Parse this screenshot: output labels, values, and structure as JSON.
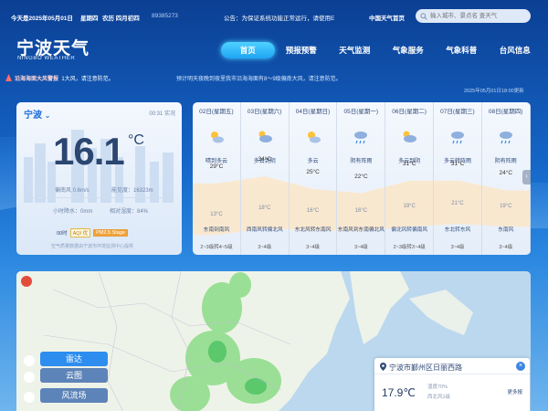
{
  "topbar": {
    "date": "今天是2025年05月01日",
    "weekday": "星期四",
    "lunar": "农历 四月初四",
    "phone": "89385273",
    "notice": "公告：为保证系统功能正常运行，请使用E",
    "cma_link": "中国天气首页",
    "search_placeholder": "输入城市、景点名 查天气"
  },
  "header": {
    "logo_cn": "宁波天气",
    "logo_en": "NINGBO WEATHER",
    "nav": [
      "首页",
      "预报预警",
      "天气监测",
      "气象服务",
      "气象科普",
      "台风信息"
    ],
    "active_index": 0
  },
  "alert": {
    "title": "沿海海面大风警报",
    "text1": "1大风，请注意防范。",
    "text2": "预计明天夜晚到夜里我市沿海海面有8～9级偏南大风，请注意防范。",
    "update": "2025年05月01日18:00更新"
  },
  "current": {
    "city": "宁波",
    "realtime": "00:31 实况",
    "temp": "16.1",
    "unit": "°C",
    "wind_label": "偏南风 0.6m/s",
    "visibility": "能见度：16323m",
    "rain": "小时降水：0mm",
    "humidity": "相对湿度：84%",
    "aqi_time": "00时",
    "aqi_label": "AQI",
    "aqi_value": "优",
    "pm_label": "PM2.5",
    "pm_value": "Stage",
    "note": "空气质量数据由宁波市环境监测中心提供"
  },
  "forecast": [
    {
      "date": "02日(星期五)",
      "desc": "晴到多云",
      "hi": "29°C",
      "lo": "13°C",
      "wind": "东南到南风",
      "level": "2~3级转4~5级",
      "icon": "sun-cloud-icon"
    },
    {
      "date": "03日(星期六)",
      "desc": "多云到阴",
      "hi": "34°C",
      "lo": "18°C",
      "wind": "西南风转偏北风",
      "level": "3~4级",
      "icon": "cloud-icon"
    },
    {
      "date": "04日(星期日)",
      "desc": "多云",
      "hi": "25°C",
      "lo": "16°C",
      "wind": "东北风转东南风",
      "level": "3~4级",
      "icon": "sun-cloud-icon"
    },
    {
      "date": "05日(星期一)",
      "desc": "阴有阵雨",
      "hi": "22°C",
      "lo": "16°C",
      "wind": "东南风到东南偏北风",
      "level": "3~4级",
      "icon": "rain-icon"
    },
    {
      "date": "06日(星期二)",
      "desc": "多云到阴",
      "hi": "31°C",
      "lo": "19°C",
      "wind": "偏北风转偏南风",
      "level": "2~3级转3~4级",
      "icon": "cloud-icon"
    },
    {
      "date": "07日(星期三)",
      "desc": "多云转阵雨",
      "hi": "31°C",
      "lo": "21°C",
      "wind": "东北转东风",
      "level": "3~4级",
      "icon": "rain-icon"
    },
    {
      "date": "08日(星期四)",
      "desc": "阴有阵雨",
      "hi": "24°C",
      "lo": "19°C",
      "wind": "东南风",
      "level": "3~4级",
      "icon": "rain-icon"
    }
  ],
  "map": {
    "layers": [
      "雷达",
      "云图",
      "风流场"
    ],
    "active_layer": 0
  },
  "location_popup": {
    "name": "宁波市鄞州区日丽西路",
    "temp": "17.9℃",
    "humidity": "湿度70%",
    "wind": "西北风1级",
    "more": "更多报"
  }
}
